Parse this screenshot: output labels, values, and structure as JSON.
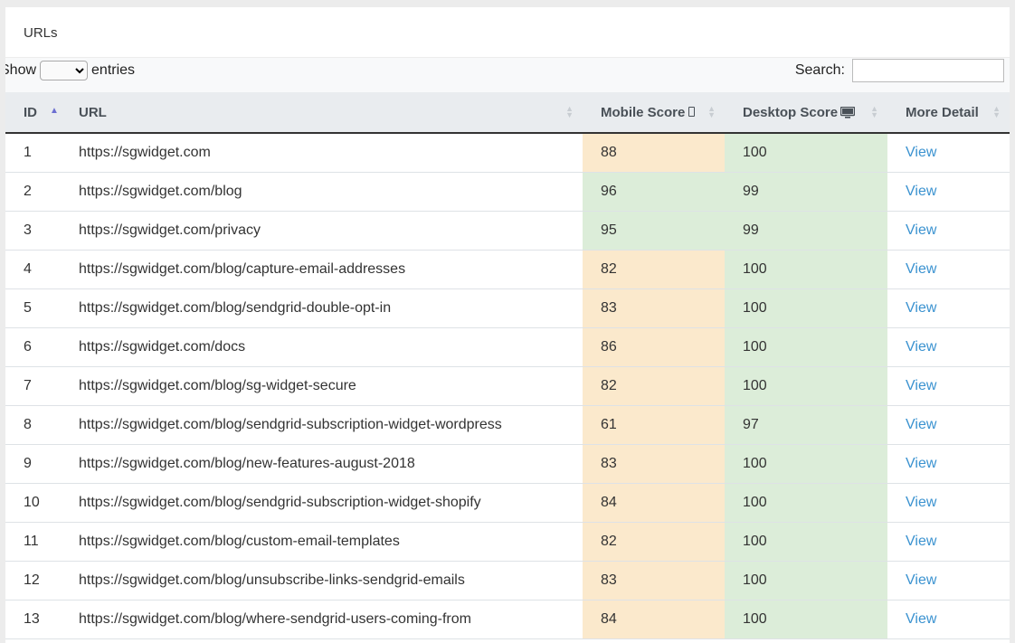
{
  "panel": {
    "title": "URLs"
  },
  "length_control": {
    "show_label": "Show",
    "entries_label": "entries",
    "selected": ""
  },
  "search": {
    "label": "Search:",
    "value": ""
  },
  "columns": {
    "id": "ID",
    "url": "URL",
    "mobile": "Mobile Score",
    "desktop": "Desktop Score",
    "detail": "More Detail"
  },
  "icons": {
    "mobile": "mobile-phone-icon",
    "desktop": "desktop-monitor-icon"
  },
  "colors": {
    "warning_bg": "#fbe9cc",
    "success_bg": "#dcedd9",
    "link": "#3a92d0"
  },
  "rows": [
    {
      "id": "1",
      "url": "https://sgwidget.com",
      "mobile": "88",
      "desktop": "100",
      "detail": "View"
    },
    {
      "id": "2",
      "url": "https://sgwidget.com/blog",
      "mobile": "96",
      "desktop": "99",
      "detail": "View"
    },
    {
      "id": "3",
      "url": "https://sgwidget.com/privacy",
      "mobile": "95",
      "desktop": "99",
      "detail": "View"
    },
    {
      "id": "4",
      "url": "https://sgwidget.com/blog/capture-email-addresses",
      "mobile": "82",
      "desktop": "100",
      "detail": "View"
    },
    {
      "id": "5",
      "url": "https://sgwidget.com/blog/sendgrid-double-opt-in",
      "mobile": "83",
      "desktop": "100",
      "detail": "View"
    },
    {
      "id": "6",
      "url": "https://sgwidget.com/docs",
      "mobile": "86",
      "desktop": "100",
      "detail": "View"
    },
    {
      "id": "7",
      "url": "https://sgwidget.com/blog/sg-widget-secure",
      "mobile": "82",
      "desktop": "100",
      "detail": "View"
    },
    {
      "id": "8",
      "url": "https://sgwidget.com/blog/sendgrid-subscription-widget-wordpress",
      "mobile": "61",
      "desktop": "97",
      "detail": "View"
    },
    {
      "id": "9",
      "url": "https://sgwidget.com/blog/new-features-august-2018",
      "mobile": "83",
      "desktop": "100",
      "detail": "View"
    },
    {
      "id": "10",
      "url": "https://sgwidget.com/blog/sendgrid-subscription-widget-shopify",
      "mobile": "84",
      "desktop": "100",
      "detail": "View"
    },
    {
      "id": "11",
      "url": "https://sgwidget.com/blog/custom-email-templates",
      "mobile": "82",
      "desktop": "100",
      "detail": "View"
    },
    {
      "id": "12",
      "url": "https://sgwidget.com/blog/unsubscribe-links-sendgrid-emails",
      "mobile": "83",
      "desktop": "100",
      "detail": "View"
    },
    {
      "id": "13",
      "url": "https://sgwidget.com/blog/where-sendgrid-users-coming-from",
      "mobile": "84",
      "desktop": "100",
      "detail": "View"
    }
  ]
}
